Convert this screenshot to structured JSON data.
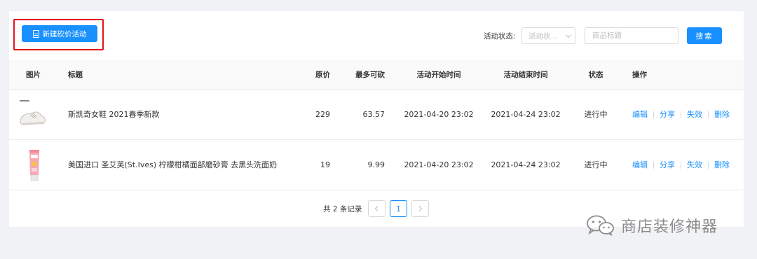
{
  "toolbar": {
    "new_button_label": "新建砍价活动",
    "status_label": "活动状态:",
    "status_placeholder": "活动状...",
    "name_placeholder": "商品标题",
    "search_label": "搜索"
  },
  "table": {
    "columns": {
      "image": "图片",
      "title": "标题",
      "original_price": "原价",
      "max_cut": "最多可砍",
      "start_time": "活动开始时间",
      "end_time": "活动结束时间",
      "status": "状态",
      "actions": "操作"
    },
    "rows": [
      {
        "image_icon": "white-sneaker-image",
        "title": "斯凯奇女鞋 2021春季新款",
        "original_price": "229",
        "max_cut": "63.57",
        "start_time": "2021-04-20 23:02",
        "end_time": "2021-04-24 23:02",
        "status": "进行中",
        "actions": [
          "编辑",
          "分享",
          "失效",
          "删除"
        ]
      },
      {
        "image_icon": "face-wash-tube-image",
        "title": "美国进口 圣艾芙(St.Ives) 柠檬柑橘面部磨砂膏 去黑头洗面奶",
        "original_price": "19",
        "max_cut": "9.99",
        "start_time": "2021-04-20 23:02",
        "end_time": "2021-04-24 23:02",
        "status": "进行中",
        "actions": [
          "编辑",
          "分享",
          "失效",
          "删除"
        ]
      }
    ]
  },
  "pagination": {
    "total_text": "共 2 条记录",
    "current_page": "1"
  },
  "watermark": {
    "text": "商店装修神器",
    "icon": "wechat-icon"
  },
  "colors": {
    "primary": "#1890ff",
    "highlight": "#e0141e"
  }
}
